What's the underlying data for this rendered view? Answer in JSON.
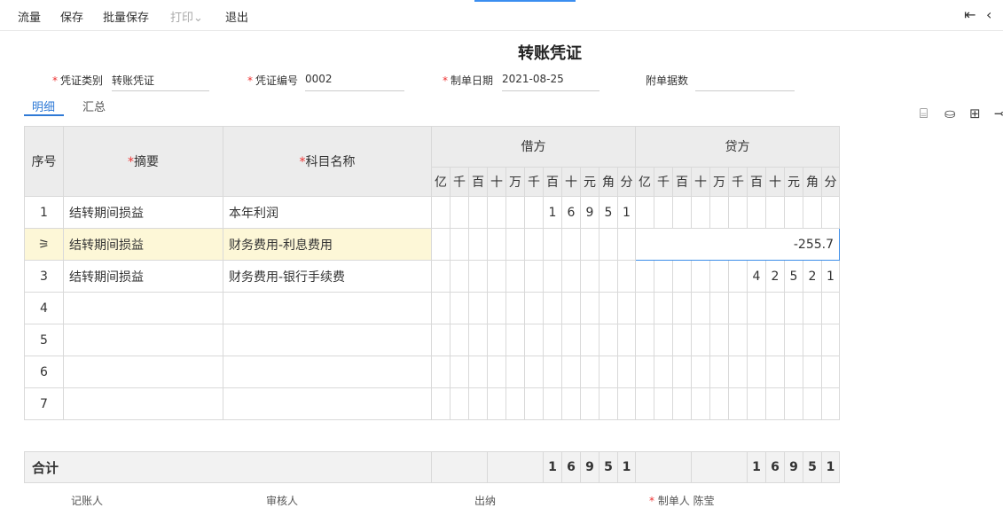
{
  "toolbar": {
    "items": [
      "流量",
      "保存",
      "批量保存",
      "打印",
      "退出"
    ],
    "print_arrow": "⌄",
    "first_icon": "⇤",
    "back_icon": "‹"
  },
  "title": "转账凭证",
  "form": {
    "voucher_type_label": "凭证类别",
    "voucher_type_value": "转账凭证",
    "voucher_no_label": "凭证编号",
    "voucher_no_value": "0002",
    "date_label": "制单日期",
    "date_value": "2021-08-25",
    "attachments_label": "附单据数",
    "attachments_value": ""
  },
  "tabs": {
    "detail": "明细",
    "summary": "汇总"
  },
  "right_icons": [
    "⌸",
    "⛀",
    "⊞",
    "⊸"
  ],
  "table": {
    "seq_header": "序号",
    "summary_header": "摘要",
    "account_header": "科目名称",
    "debit_header": "借方",
    "credit_header": "贷方",
    "units": [
      "亿",
      "千",
      "百",
      "十",
      "万",
      "千",
      "百",
      "十",
      "元",
      "角",
      "分"
    ],
    "rows": [
      {
        "seq": "1",
        "summary": "结转期间损益",
        "account": "本年利润",
        "debit": [
          "",
          "",
          "",
          "",
          "",
          "",
          "1",
          "6",
          "9",
          "5",
          "1"
        ],
        "credit": [
          "",
          "",
          "",
          "",
          "",
          "",
          "",
          "",
          "",
          "",
          ""
        ]
      },
      {
        "seq": "⚞",
        "summary": "结转期间损益",
        "account": "财务费用-利息费用",
        "debit": [
          "",
          "",
          "",
          "",
          "",
          "",
          "",
          "",
          "",
          "",
          ""
        ],
        "credit_input": "-255.7"
      },
      {
        "seq": "3",
        "summary": "结转期间损益",
        "account": "财务费用-银行手续费",
        "debit": [
          "",
          "",
          "",
          "",
          "",
          "",
          "",
          "",
          "",
          "",
          ""
        ],
        "credit": [
          "",
          "",
          "",
          "",
          "",
          "",
          "4",
          "2",
          "5",
          "2",
          "1"
        ]
      },
      {
        "seq": "4",
        "summary": "",
        "account": "",
        "debit": [
          "",
          "",
          "",
          "",
          "",
          "",
          "",
          "",
          "",
          "",
          ""
        ],
        "credit": [
          "",
          "",
          "",
          "",
          "",
          "",
          "",
          "",
          "",
          "",
          ""
        ]
      },
      {
        "seq": "5",
        "summary": "",
        "account": "",
        "debit": [
          "",
          "",
          "",
          "",
          "",
          "",
          "",
          "",
          "",
          "",
          ""
        ],
        "credit": [
          "",
          "",
          "",
          "",
          "",
          "",
          "",
          "",
          "",
          "",
          ""
        ]
      },
      {
        "seq": "6",
        "summary": "",
        "account": "",
        "debit": [
          "",
          "",
          "",
          "",
          "",
          "",
          "",
          "",
          "",
          "",
          ""
        ],
        "credit": [
          "",
          "",
          "",
          "",
          "",
          "",
          "",
          "",
          "",
          "",
          ""
        ]
      },
      {
        "seq": "7",
        "summary": "",
        "account": "",
        "debit": [
          "",
          "",
          "",
          "",
          "",
          "",
          "",
          "",
          "",
          "",
          ""
        ],
        "credit": [
          "",
          "",
          "",
          "",
          "",
          "",
          "",
          "",
          "",
          "",
          ""
        ]
      }
    ],
    "total_label": "合计",
    "total_debit": [
      "1",
      "6",
      "9",
      "5",
      "1"
    ],
    "total_credit": [
      "1",
      "6",
      "9",
      "5",
      "1"
    ]
  },
  "footer": {
    "bookkeeper": "记账人",
    "reviewer": "审核人",
    "cashier": "出纳",
    "maker_label": "制单人",
    "maker_value": "陈莹"
  }
}
